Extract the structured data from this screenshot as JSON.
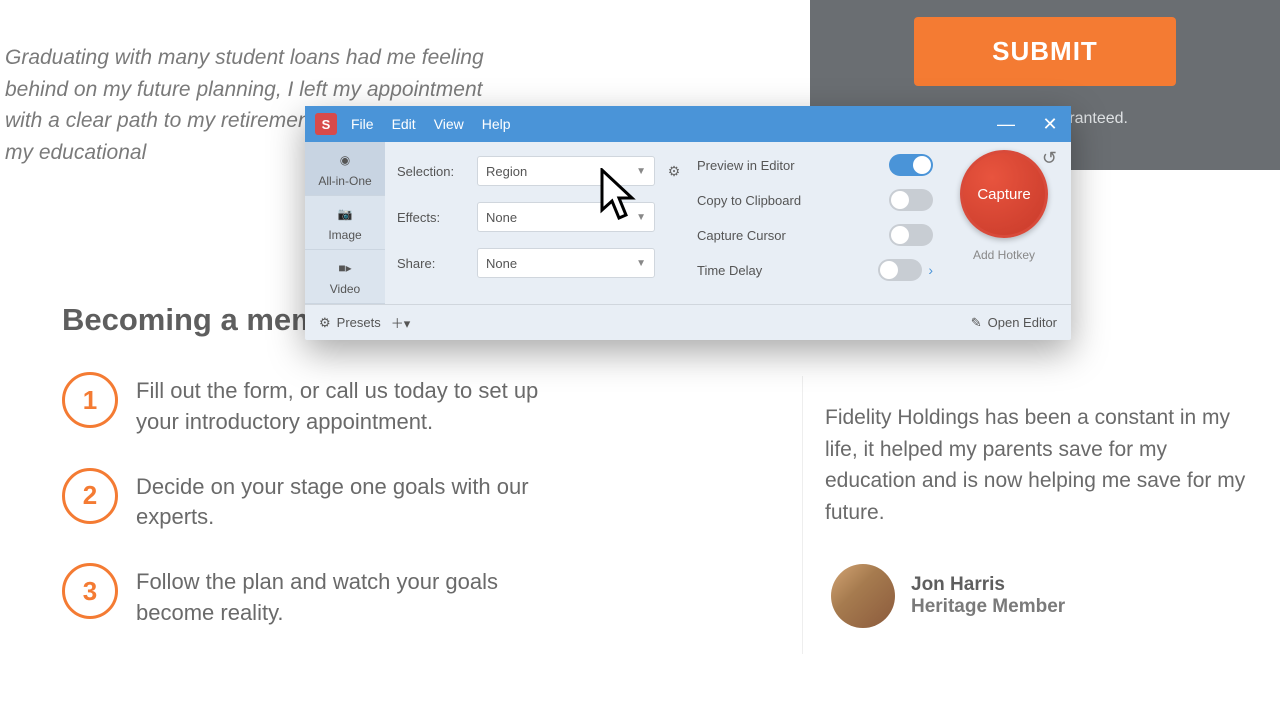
{
  "page": {
    "testimonialTop": "Graduating with many student loans had me feeling behind on my future planning, I left my appointment with a clear path to my retirement able to pay down my educational",
    "submit": "SUBMIT",
    "guaranteed": "aranteed.",
    "sectionTitle": "Becoming a mem",
    "steps": [
      {
        "num": "1",
        "text": "Fill out the form, or call us today to set up your introductory appointment."
      },
      {
        "num": "2",
        "text": "Decide on your stage one goals with our experts."
      },
      {
        "num": "3",
        "text": "Follow the plan and watch your goals become reality."
      }
    ],
    "testimonialCard": {
      "text": "Fidelity Holdings has been a constant in my life, it helped my parents save for my education and is now helping me save for my future.",
      "name": "Jon Harris",
      "title": "Heritage Member"
    }
  },
  "snagit": {
    "appIcon": "S",
    "menu": {
      "file": "File",
      "edit": "Edit",
      "view": "View",
      "help": "Help"
    },
    "modes": {
      "allInOne": "All-in-One",
      "image": "Image",
      "video": "Video"
    },
    "config": {
      "selectionLabel": "Selection:",
      "selectionValue": "Region",
      "effectsLabel": "Effects:",
      "effectsValue": "None",
      "shareLabel": "Share:",
      "shareValue": "None"
    },
    "toggles": {
      "preview": "Preview in Editor",
      "clipboard": "Copy to Clipboard",
      "cursor": "Capture Cursor",
      "delay": "Time Delay"
    },
    "capture": "Capture",
    "addHotkey": "Add Hotkey",
    "presets": "Presets",
    "openEditor": "Open Editor"
  }
}
